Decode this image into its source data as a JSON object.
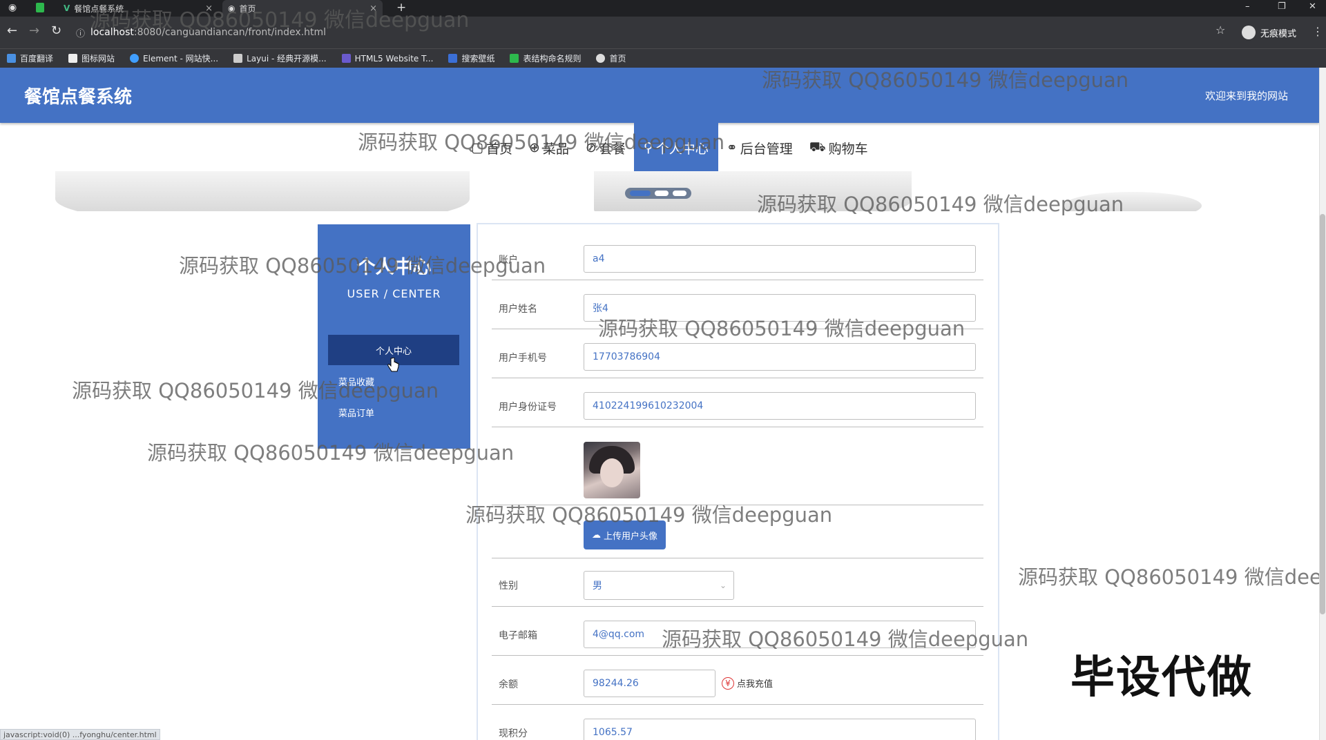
{
  "browser": {
    "tabs": [
      {
        "label": "餐馆点餐系统"
      },
      {
        "label": "首页"
      }
    ],
    "url_host": "localhost",
    "url_path": ":8080/canguandiancan/front/index.html",
    "profile_label": "无痕模式",
    "bookmarks": [
      "百度翻译",
      "图标网站",
      "Element - 网站快...",
      "Layui - 经典开源模...",
      "HTML5 Website T...",
      "搜索壁纸",
      "表结构命名规则",
      "首页"
    ]
  },
  "header": {
    "title": "餐馆点餐系统",
    "welcome": "欢迎来到我的网站"
  },
  "nav": [
    {
      "label": "首页",
      "icon": "home-icon"
    },
    {
      "label": "菜品",
      "icon": "dish-icon"
    },
    {
      "label": "套餐",
      "icon": "combo-icon"
    },
    {
      "label": "个人中心",
      "icon": "user-icon",
      "active": true
    },
    {
      "label": "后台管理",
      "icon": "link-icon"
    },
    {
      "label": "购物车",
      "icon": "cart-icon"
    }
  ],
  "sidebar": {
    "title": "个人中心",
    "subtitle": "USER / CENTER",
    "items": [
      {
        "label": "个人中心",
        "active": true
      },
      {
        "label": "菜品收藏"
      },
      {
        "label": "菜品订单"
      }
    ]
  },
  "form": {
    "account_label": "账户",
    "account_value": "a4",
    "name_label": "用户姓名",
    "name_value": "张4",
    "phone_label": "用户手机号",
    "phone_value": "17703786904",
    "idcard_label": "用户身份证号",
    "idcard_value": "410224199610232004",
    "upload_label": "上传用户头像",
    "gender_label": "性别",
    "gender_value": "男",
    "email_label": "电子邮箱",
    "email_value": "4@qq.com",
    "balance_label": "余额",
    "balance_value": "98244.26",
    "recharge_label": "点我充值",
    "points_label": "现积分",
    "points_value": "1065.57"
  },
  "watermark": "源码获取 QQ86050149 微信deepguan",
  "big_watermark": "毕设代做",
  "status_text": "javascript:void(0) ...fyonghu/center.html",
  "colors": {
    "primary": "#4472c4",
    "sidebar_active": "#1f3f83"
  }
}
